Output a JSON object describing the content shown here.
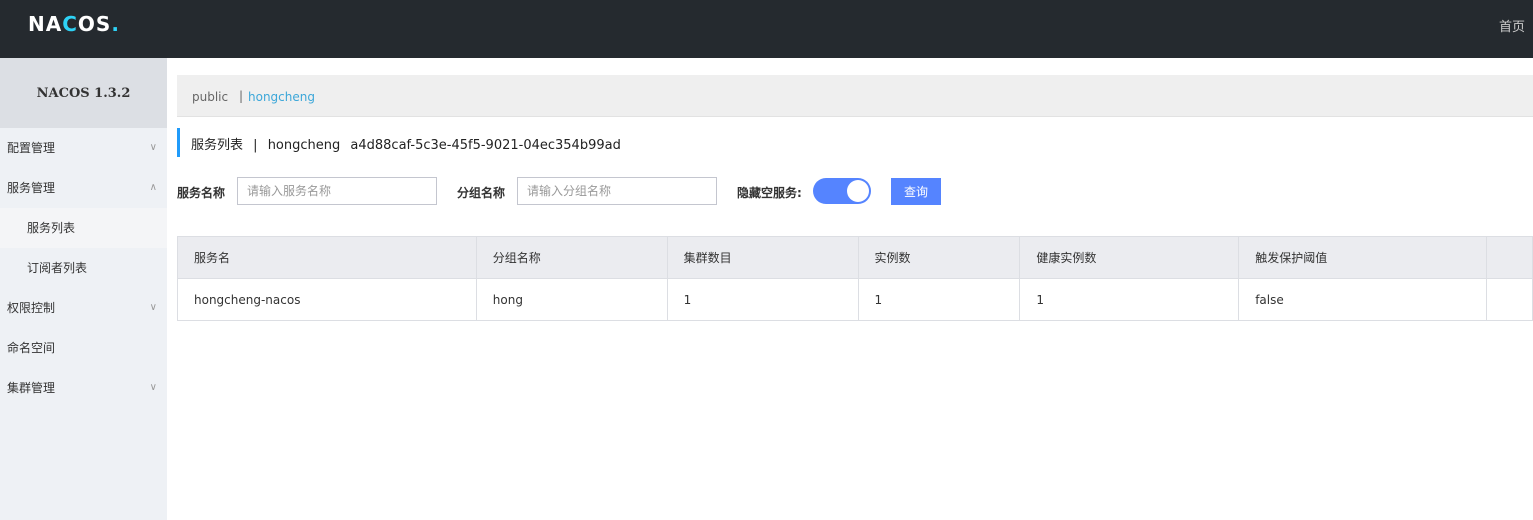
{
  "header": {
    "logo_a": "NA",
    "logo_b": "C",
    "logo_c": "OS",
    "logo_dot": ".",
    "home": "首页"
  },
  "sidebar": {
    "version": "NACOS 1.3.2",
    "items": [
      {
        "label": "配置管理",
        "chevron": "chevron-down-icon"
      },
      {
        "label": "服务管理",
        "chevron": "chevron-up-icon"
      },
      {
        "label": "服务列表",
        "sub": true,
        "active": true
      },
      {
        "label": "订阅者列表",
        "sub": true
      },
      {
        "label": "权限控制",
        "chevron": "chevron-down-icon"
      },
      {
        "label": "命名空间"
      },
      {
        "label": "集群管理",
        "chevron": "chevron-down-icon"
      }
    ]
  },
  "namespace": {
    "public": "public",
    "separator": "|",
    "active": "hongcheng"
  },
  "title": {
    "main": "服务列表",
    "sep": "|",
    "ns_name": "hongcheng",
    "ns_id": "a4d88caf-5c3e-45f5-9021-04ec354b99ad"
  },
  "filters": {
    "service_label": "服务名称",
    "service_placeholder": "请输入服务名称",
    "group_label": "分组名称",
    "group_placeholder": "请输入分组名称",
    "hide_empty_label": "隐藏空服务:",
    "hide_empty_on": true,
    "query_button": "查询"
  },
  "table": {
    "columns": [
      "服务名",
      "分组名称",
      "集群数目",
      "实例数",
      "健康实例数",
      "触发保护阈值",
      ""
    ],
    "rows": [
      [
        "hongcheng-nacos",
        "hong",
        "1",
        "1",
        "1",
        "false",
        ""
      ]
    ]
  },
  "colors": {
    "header_bg": "#252a2f",
    "accent": "#5584ff",
    "link": "#3ca7d9"
  }
}
